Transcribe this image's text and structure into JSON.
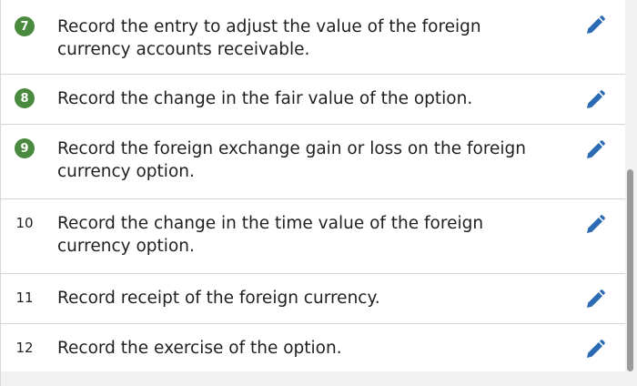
{
  "steps": [
    {
      "num": "7",
      "badge": true,
      "text": "Record the entry to adjust the value of the foreign currency accounts receivable."
    },
    {
      "num": "8",
      "badge": true,
      "text": "Record the change in the fair value of the option."
    },
    {
      "num": "9",
      "badge": true,
      "text": "Record the foreign exchange gain or loss on the foreign currency option."
    },
    {
      "num": "10",
      "badge": false,
      "text": "Record the change in the time value of the foreign currency option."
    },
    {
      "num": "11",
      "badge": false,
      "text": "Record receipt of the foreign currency."
    },
    {
      "num": "12",
      "badge": false,
      "text": "Record the exercise of the option."
    }
  ],
  "icons": {
    "edit": "pencil-icon",
    "badge_color": "#4a8a3e",
    "edit_color": "#2b6bb3"
  }
}
